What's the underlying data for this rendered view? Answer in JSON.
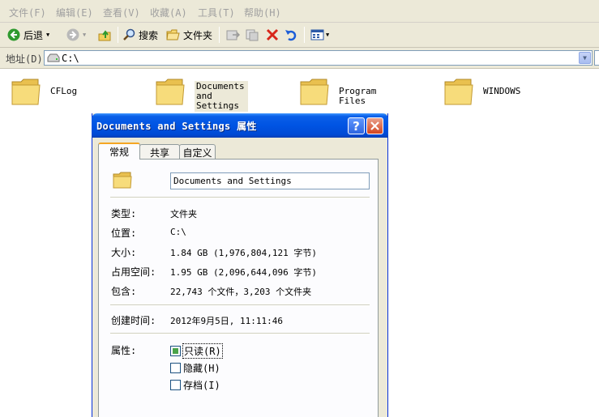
{
  "menu": [
    "文件(F)",
    "编辑(E)",
    "查看(V)",
    "收藏(A)",
    "工具(T)",
    "帮助(H)"
  ],
  "toolbar": {
    "back_label": "后退",
    "search_label": "搜索",
    "folders_label": "文件夹"
  },
  "address": {
    "label": "地址(D)",
    "value": "C:\\"
  },
  "folders": [
    {
      "name": "CFLog"
    },
    {
      "name": "Documents and\nSettings"
    },
    {
      "name": "Program Files"
    },
    {
      "name": "WINDOWS"
    }
  ],
  "dialog": {
    "title": "Documents and Settings 属性",
    "tabs": [
      "常规",
      "共享",
      "自定义"
    ],
    "name_value": "Documents and Settings",
    "rows": {
      "type": {
        "label": "类型:",
        "value": "文件夹"
      },
      "location": {
        "label": "位置:",
        "value": "C:\\"
      },
      "size": {
        "label": "大小:",
        "value": "1.84 GB (1,976,804,121 字节)"
      },
      "ondisk": {
        "label": "占用空间:",
        "value": "1.95 GB (2,096,644,096 字节)"
      },
      "contains": {
        "label": "包含:",
        "value": "22,743 个文件，3,203 个文件夹"
      },
      "created": {
        "label": "创建时间:",
        "value": "2012年9月5日, 11:11:46"
      }
    },
    "attributes_label": "属性:",
    "attributes": [
      {
        "label": "只读(R)",
        "state": "indeterminate"
      },
      {
        "label": "隐藏(H)",
        "state": "unchecked"
      },
      {
        "label": "存档(I)",
        "state": "unchecked"
      }
    ]
  },
  "colors": {
    "titlebar": "#0054e3",
    "chrome": "#ece9d8",
    "folder": "#f5d76e"
  }
}
